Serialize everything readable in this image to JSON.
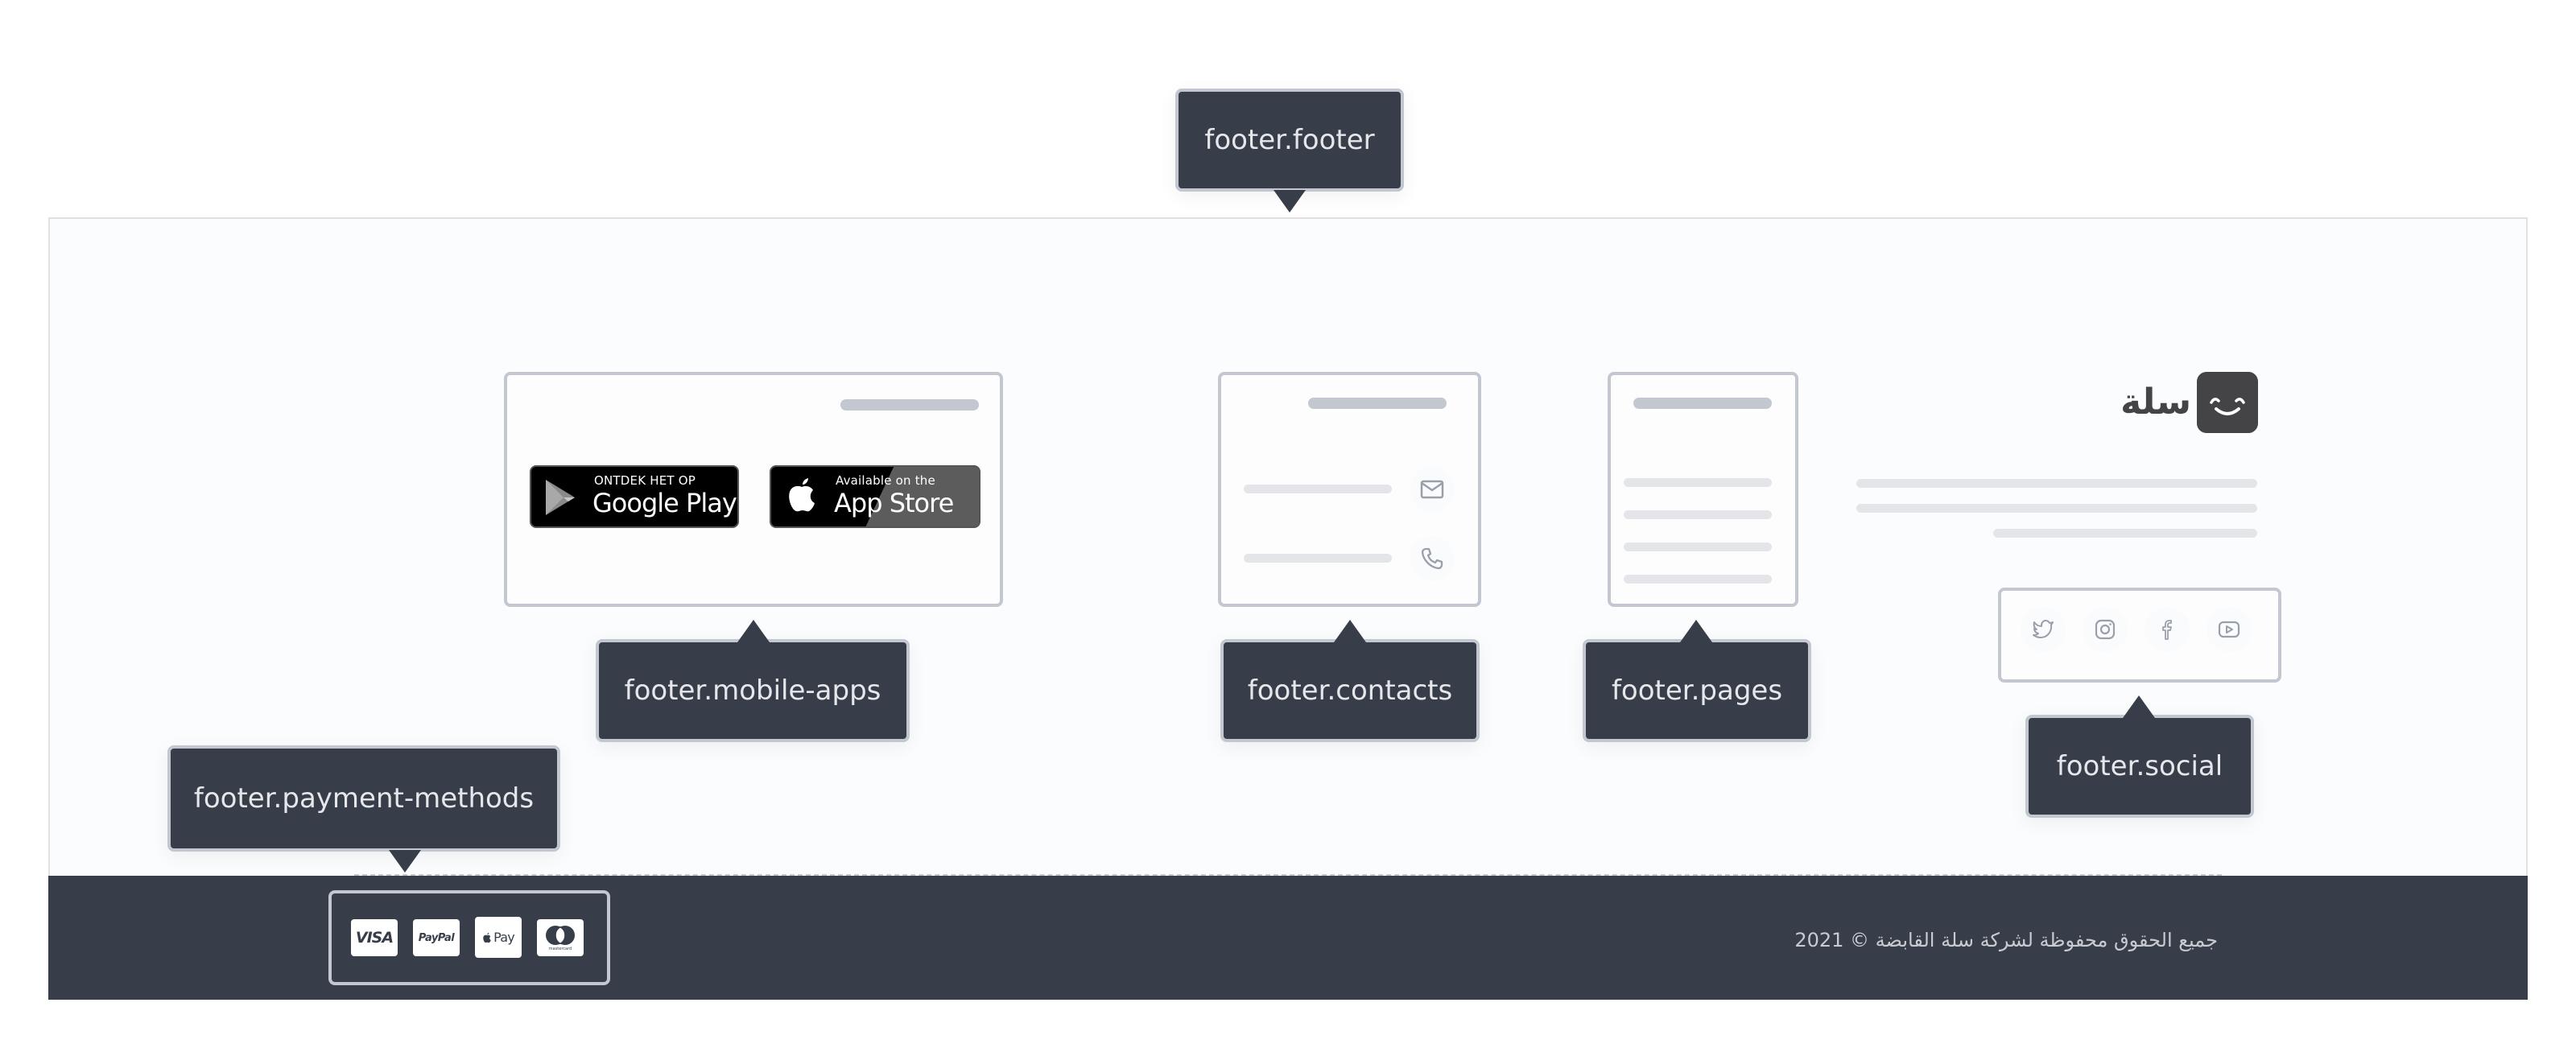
{
  "footer": {
    "tooltips": {
      "footer": "footer.footer",
      "mobile_apps": "footer.mobile-apps",
      "contacts": "footer.contacts",
      "pages": "footer.pages",
      "social": "footer.social",
      "payment_methods": "footer.payment-methods"
    },
    "brand": {
      "name": "سلة",
      "logo_icon": "smile-face-icon"
    },
    "mobile_apps": {
      "google_play": {
        "small": "ONTDEK HET OP",
        "big": "Google Play",
        "icon": "google-play-icon"
      },
      "app_store": {
        "small": "Available on the",
        "big": "App Store",
        "icon": "apple-icon"
      }
    },
    "contacts": {
      "items": [
        {
          "icon": "mail-icon"
        },
        {
          "icon": "phone-icon"
        }
      ]
    },
    "social": {
      "items": [
        {
          "icon": "twitter-icon"
        },
        {
          "icon": "instagram-icon"
        },
        {
          "icon": "facebook-icon"
        },
        {
          "icon": "youtube-icon"
        }
      ]
    },
    "payment_methods": {
      "items": [
        {
          "label": "VISA",
          "icon": "visa-icon"
        },
        {
          "label": "PayPal",
          "icon": "paypal-icon"
        },
        {
          "label": "Pay",
          "icon": "apple-pay-icon"
        },
        {
          "label": "mastercard",
          "icon": "mastercard-icon"
        }
      ]
    },
    "copyright": "جميع الحقوق محفوظة لشركة سلة القابضة © 2021"
  },
  "colors": {
    "footer_dark": "#383d4a",
    "footer_light": "#fbfcfd",
    "wireframe_border": "#c3c7d0",
    "tooltip_bg": "#383d4a",
    "tooltip_text": "#e6e7ea",
    "logo": "#444446"
  }
}
